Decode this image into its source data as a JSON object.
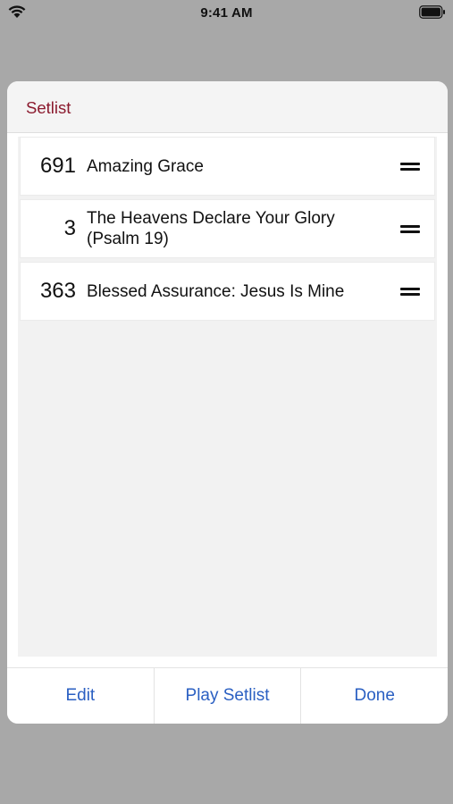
{
  "status_bar": {
    "time": "9:41 AM",
    "wifi_icon": "wifi-icon",
    "battery_icon": "battery-icon"
  },
  "modal": {
    "title": "Setlist",
    "title_color": "#8b1a2e",
    "songs": [
      {
        "number": "691",
        "title": "Amazing Grace",
        "handle_icon": "drag-handle-icon"
      },
      {
        "number": "3",
        "title": "The Heavens Declare Your Glory (Psalm 19)",
        "handle_icon": "drag-handle-icon"
      },
      {
        "number": "363",
        "title": "Blessed Assurance: Jesus Is Mine",
        "handle_icon": "drag-handle-icon"
      }
    ],
    "buttons": {
      "edit": "Edit",
      "play": "Play Setlist",
      "done": "Done"
    },
    "button_color": "#2a5fc2"
  }
}
